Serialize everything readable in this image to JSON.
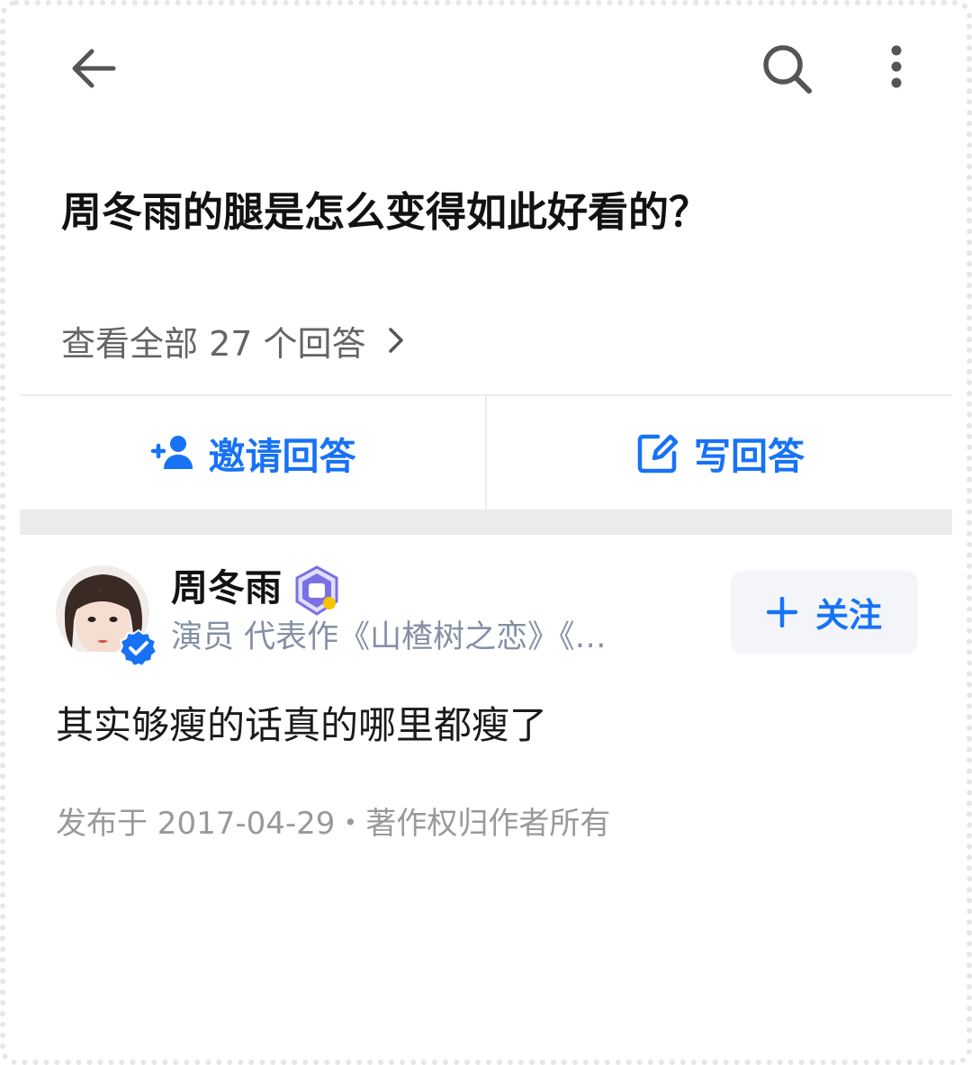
{
  "question": {
    "title": "周冬雨的腿是怎么变得如此好看的？",
    "view_all": "查看全部 27 个回答"
  },
  "actions": {
    "invite_label": "邀请回答",
    "write_label": "写回答"
  },
  "author": {
    "name": "周冬雨",
    "description": "演员 代表作《山楂树之恋》《…",
    "follow_label": "关注"
  },
  "answer": {
    "text": "其实够瘦的话真的哪里都瘦了",
    "meta": "发布于 2017-04-29・著作权归作者所有"
  },
  "colors": {
    "accent": "#1772f6",
    "secondary_text": "#8590a6",
    "meta_text": "#999999"
  },
  "icons": [
    "back-arrow-icon",
    "search-icon",
    "more-vertical-icon",
    "chevron-right-icon",
    "add-person-icon",
    "edit-icon",
    "verified-icon",
    "badge-icon",
    "plus-icon"
  ]
}
